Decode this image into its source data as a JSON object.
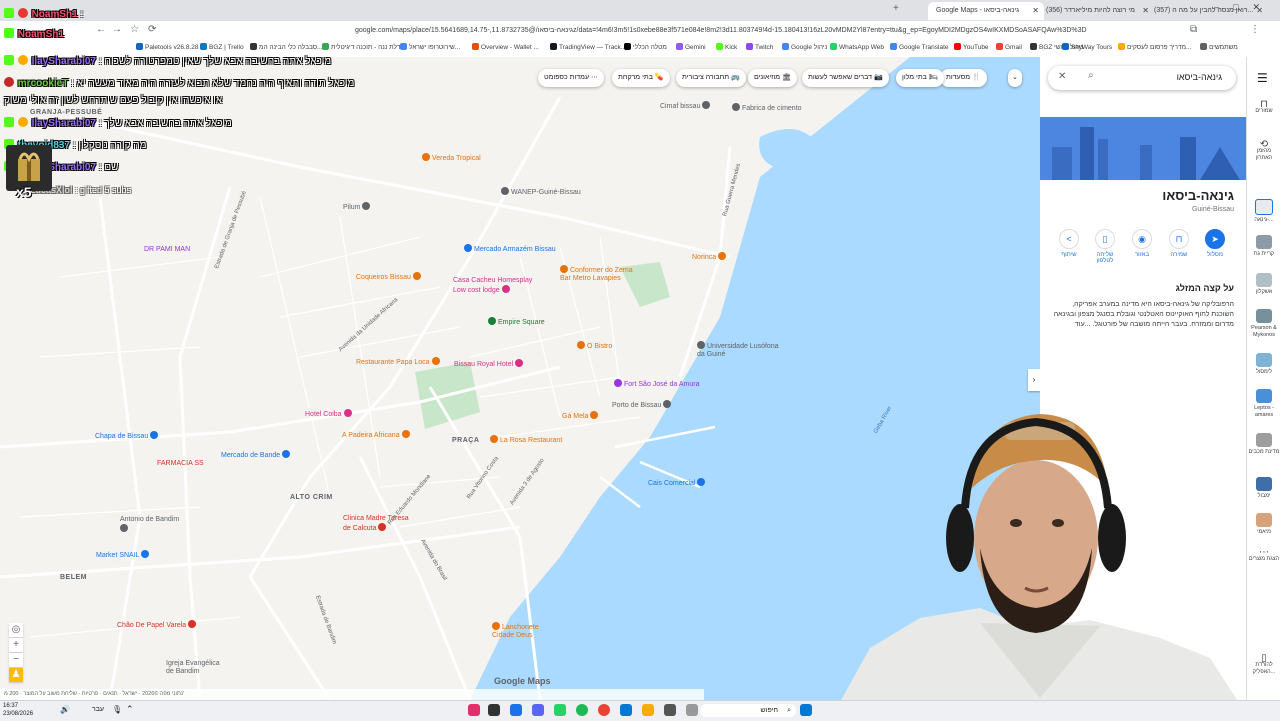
{
  "browser": {
    "tabs": [
      {
        "title": "Google Maps - גינאה-ביסאו",
        "active": true
      },
      {
        "title": "(356) מי רוצה להיות מיליארדר",
        "active": false
      },
      {
        "title": "(357) רואן מנסה להבין על מה ה...",
        "active": false
      }
    ],
    "url": "google.com/maps/place/גינאה-ביסאו/@11.8732735,-15.5641689,14.75z/data=!4m6!3m5!1s0xebe88e3f571e084e!8m2!3d11.803749!4d-15.180413!16zL20vMDM2Yl87entry=ttu&g_ep=EgoyMDI2MDgzOS4wIKXMDSoASAFQAw%3D%3D",
    "bookmarks": [
      "Paletools v26.8.28",
      "BGZ | Trello",
      "סבבלה כלי הבינה המ...",
      "דלת ננה - תוכנה דיגיטלית",
      "שירוטרופו ישראל...",
      "Overview - Wallet ...",
      "TradingView — Track...",
      "מטלה הכללי",
      "Gemini",
      "Kick",
      "Twitch",
      "Google ניהול",
      "WhatsApp Web",
      "Google Translate",
      "YouTube",
      "Gmail",
      "BGZ ניהול ראשי",
      "SkyWay Tours",
      "מדריך פרסום לעסקים...",
      "משתמשים"
    ]
  },
  "map": {
    "chips": [
      "מסעדות",
      "בתי מלון",
      "דברים שאפשר לעשות",
      "מוזיאונים",
      "תחבורה ציבורית",
      "בתי מרקחת",
      "עמדות כספומט"
    ],
    "pois": [
      {
        "label": "Vereda Tropical",
        "color": "#e8710a"
      },
      {
        "label": "WANEP-Guiné-Bissau",
        "color": "#5f6368"
      },
      {
        "label": "Pilum",
        "color": "#5f6368"
      },
      {
        "label": "Mercado Armazém Bissau",
        "color": "#1a73e8"
      },
      {
        "label": "Coqueiros Bissau",
        "color": "#e8710a"
      },
      {
        "label": "Casa Cacheu Homesplay Low cost lodge",
        "color": "#d93085"
      },
      {
        "label": "Conformer do Zema Bar Metro Lavapies",
        "color": "#e8710a"
      },
      {
        "label": "Empire Square",
        "color": "#188038"
      },
      {
        "label": "Restaurante Papa Loca",
        "color": "#e8710a"
      },
      {
        "label": "Bissau Royal Hotel",
        "color": "#d93085"
      },
      {
        "label": "O Bistro",
        "color": "#e8710a"
      },
      {
        "label": "Universidade Lusófona da Guiné",
        "color": "#5f6368"
      },
      {
        "label": "Fort São José da Amura",
        "color": "#9334e6"
      },
      {
        "label": "Porto de Bissau",
        "color": "#5f6368"
      },
      {
        "label": "Hotel Coiba",
        "color": "#d93085"
      },
      {
        "label": "A Padeira Africana",
        "color": "#e8710a"
      },
      {
        "label": "La Rosa Restaurant",
        "color": "#e8710a"
      },
      {
        "label": "Gá Mela",
        "color": "#e8710a"
      },
      {
        "label": "Chapa de Bissau",
        "color": "#1a73e8"
      },
      {
        "label": "Mercado de Bande",
        "color": "#1a73e8"
      },
      {
        "label": "FARMACIA SS",
        "color": "#d93025"
      },
      {
        "label": "Antonio de Bandim",
        "color": "#5f6368"
      },
      {
        "label": "Clinica Madre Teresa de Calcuta",
        "color": "#d93025"
      },
      {
        "label": "Market SNAIL",
        "color": "#1a73e8"
      },
      {
        "label": "Chão De Papel Varela",
        "color": "#d93025"
      },
      {
        "label": "Igreja Evangélica de Bandim",
        "color": "#5f6368"
      },
      {
        "label": "Lanchonete Cidade Deus",
        "color": "#e8710a"
      },
      {
        "label": "Norinca",
        "color": "#e8710a"
      },
      {
        "label": "Cimaf bissau",
        "color": "#5f6368"
      },
      {
        "label": "Fabrica de cimento",
        "color": "#5f6368"
      },
      {
        "label": "Cais Comercial",
        "color": "#1a73e8"
      },
      {
        "label": "DR PAMI MAN",
        "color": "#9334e6"
      }
    ],
    "neighborhoods": [
      "GRANJA-PESSUBÉ",
      "PRAÇA",
      "ALTO CRIM",
      "BELEM"
    ],
    "streets": [
      "Estrada de Granja de Pessubé",
      "Avenida da Unidade Africana",
      "Rua Eduardo Mondlane",
      "Rua Vitorino Costa",
      "Avenida 3 de Agosto",
      "Avenida do Brasil",
      "Estrada de Bandim",
      "Rua Guerra Mendes"
    ],
    "water_label": "Geba River",
    "logo": "Google Maps",
    "scalebar": "נתוני מפה ©2026 · ישראל · תנאים · פרטיות · שליחת משוב על המוצר · 200 מ'",
    "colors": {
      "land": "#f4f3ef",
      "water": "#aadaff",
      "park": "#c8e6c9",
      "road": "#ffffff"
    }
  },
  "panel": {
    "search_query": "גינאה-ביסאו",
    "title": "גינאה-ביסאו",
    "subtitle": "Guiné-Bissau",
    "actions": [
      "מסלול",
      "שמירה",
      "באזור",
      "שליחה לטלפון",
      "שיתוף"
    ],
    "about_heading": "על קצה המזלג",
    "about_text": "הרפובליקה של גינאה-ביסאו היא מדינה במערב אפריקה, השוכנת לחוף האוקיינוס האטלנטי וגובלת בסנגל מצפון ובגינאה מדרום וממזרח. בעבר הייתה מושבה של פורטוגל. ...עוד"
  },
  "rail": [
    {
      "label": "שמורים"
    },
    {
      "label": "מהזמן האחרון"
    },
    {
      "label": "גינאה-..."
    },
    {
      "label": "קריית גת"
    },
    {
      "label": "אשקלון"
    },
    {
      "label": "Pearson & Mykonos"
    },
    {
      "label": "לימסול"
    },
    {
      "label": "Leptos - amares"
    },
    {
      "label": "מדינת מכבים"
    },
    {
      "label": "ימבול"
    },
    {
      "label": "מיאמי"
    },
    {
      "label": "הצגת מוצרים"
    },
    {
      "label": "להורדת האפליק..."
    }
  ],
  "chat": [
    {
      "user": "NoamSh1",
      "msg": ":",
      "color": "#ff4d6d"
    },
    {
      "user": "NoamSh1",
      "msg": "",
      "color": "#ff4d6d"
    },
    {
      "user": "IlaySharabi07",
      "msg": ": מיכאל אתה בחשיבה אבא שלך שאין טמפרטורה לשכוח",
      "color": "#9b6bff"
    },
    {
      "user": "mrcookieT",
      "msg": ": מיכאל תודה ותאיף היה נחמד שלא תבוא לעזרה היה מאוד מעשה יא",
      "color": "#6bd13a"
    },
    {
      "user": "",
      "msg": "או איכשהו אין קיבול פעם שיתרחש לשון זה אולי משוק",
      "color": "#ffffff"
    },
    {
      "user": "IlaySharabi07",
      "msg": ": מיכאל אתה בחשיבה אבא שלך",
      "color": "#9b6bff"
    },
    {
      "user": "thevoid837",
      "msg": ": מה קורה נוסקלון",
      "color": "#4dd0e1"
    },
    {
      "user": "IlaySharabi07",
      "msg": ": שם",
      "color": "#9b6bff"
    },
    {
      "user": "LucasXlol",
      "msg": ": gifted 5 subs",
      "color": "#bdbdbd"
    }
  ],
  "gift_count": "x5",
  "taskbar": {
    "time": "16:37",
    "date": "23/08/2026",
    "search_placeholder": "חיפוש",
    "lang": "עבר"
  }
}
